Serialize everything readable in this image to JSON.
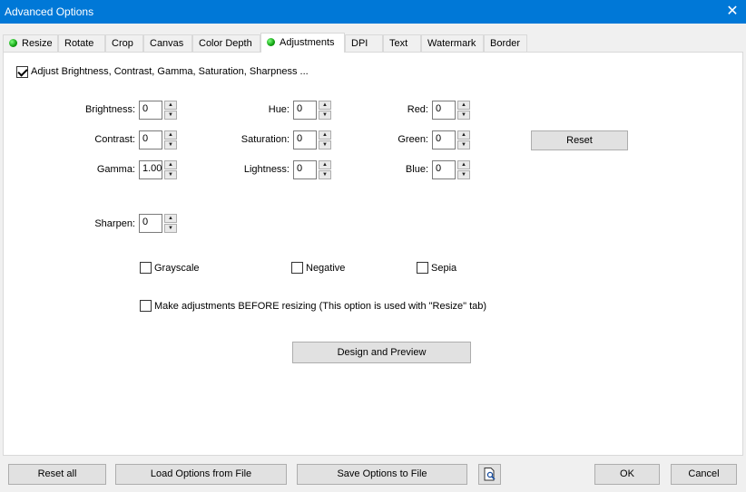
{
  "window": {
    "title": "Advanced Options",
    "close_glyph": "✕"
  },
  "tabs": [
    {
      "label": "Resize",
      "dot": true
    },
    {
      "label": "Rotate"
    },
    {
      "label": "Crop"
    },
    {
      "label": "Canvas"
    },
    {
      "label": "Color Depth"
    },
    {
      "label": "Adjustments",
      "dot": true,
      "active": true
    },
    {
      "label": "DPI"
    },
    {
      "label": "Text"
    },
    {
      "label": "Watermark"
    },
    {
      "label": "Border"
    }
  ],
  "adjust": {
    "enable_label": "Adjust Brightness, Contrast, Gamma, Saturation, Sharpness ...",
    "enabled": true,
    "fields": {
      "brightness": {
        "label": "Brightness:",
        "value": "0"
      },
      "contrast": {
        "label": "Contrast:",
        "value": "0"
      },
      "gamma": {
        "label": "Gamma:",
        "value": "1.00"
      },
      "hue": {
        "label": "Hue:",
        "value": "0"
      },
      "saturation": {
        "label": "Saturation:",
        "value": "0"
      },
      "lightness": {
        "label": "Lightness:",
        "value": "0"
      },
      "red": {
        "label": "Red:",
        "value": "0"
      },
      "green": {
        "label": "Green:",
        "value": "0"
      },
      "blue": {
        "label": "Blue:",
        "value": "0"
      },
      "sharpen": {
        "label": "Sharpen:",
        "value": "0"
      }
    },
    "reset_label": "Reset",
    "grayscale_label": "Grayscale",
    "negative_label": "Negative",
    "sepia_label": "Sepia",
    "before_resize_label": "Make adjustments BEFORE resizing (This option is used with \"Resize\" tab)",
    "design_preview_label": "Design and Preview"
  },
  "footer": {
    "reset_all": "Reset all",
    "load": "Load Options from File",
    "save": "Save Options to File",
    "ok": "OK",
    "cancel": "Cancel"
  },
  "icons": {
    "spin_up": "▲",
    "spin_down": "▼"
  }
}
